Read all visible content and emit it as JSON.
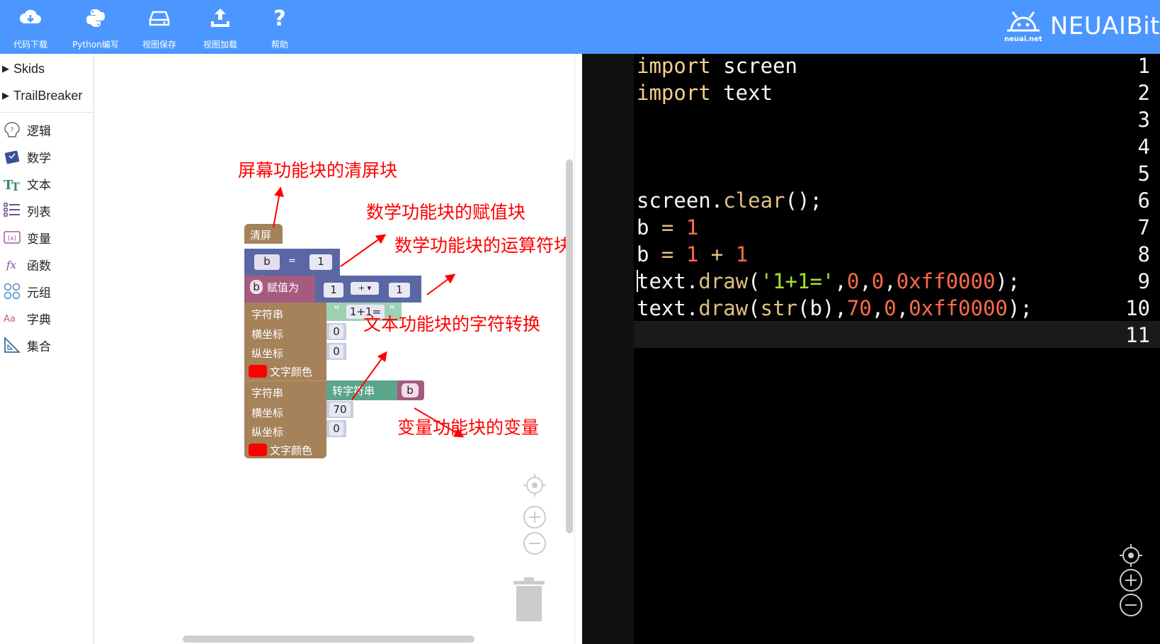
{
  "toolbar": {
    "buttons": [
      {
        "label": "代码下载",
        "icon": "cloud-download-icon"
      },
      {
        "label": "Python编写",
        "icon": "python-icon"
      },
      {
        "label": "视图保存",
        "icon": "drive-save-icon"
      },
      {
        "label": "视图加载",
        "icon": "upload-icon"
      },
      {
        "label": "帮助",
        "icon": "help-icon"
      }
    ],
    "brand_small": "neuai.net",
    "brand_name": "NEUAIBit",
    "color": "#4c97ff"
  },
  "toolbox": {
    "tree": [
      {
        "label": "Skids",
        "icon": "caret-right-icon"
      },
      {
        "label": "TrailBreaker",
        "icon": "caret-right-icon"
      }
    ],
    "categories": [
      {
        "label": "逻辑",
        "icon": "logic-icon"
      },
      {
        "label": "数学",
        "icon": "math-icon"
      },
      {
        "label": "文本",
        "icon": "text-icon"
      },
      {
        "label": "列表",
        "icon": "list-icon"
      },
      {
        "label": "变量",
        "icon": "variable-icon"
      },
      {
        "label": "函数",
        "icon": "function-icon"
      },
      {
        "label": "元组",
        "icon": "tuple-icon"
      },
      {
        "label": "字典",
        "icon": "dict-icon"
      },
      {
        "label": "集合",
        "icon": "set-icon"
      }
    ]
  },
  "blocks": {
    "clear_label": "清屏",
    "assign_var": "b",
    "assign_eq": "=",
    "assign_value": "1",
    "setvar_var": "b",
    "setvar_label": "赋值为",
    "op_left": "1",
    "op_symbol": "+ ▾",
    "op_right": "1",
    "draw1": {
      "string_label": "字符串",
      "string_value": "1+1=",
      "x_label": "横坐标",
      "x_value": "0",
      "y_label": "纵坐标",
      "y_value": "0",
      "color_label": "文字颜色"
    },
    "draw2": {
      "string_label": "字符串",
      "convert_label": "转字符串",
      "convert_var": "b",
      "x_label": "横坐标",
      "x_value": "70",
      "y_label": "纵坐标",
      "y_value": "0",
      "color_label": "文字颜色"
    },
    "text_color": "#ff0000"
  },
  "annotations": {
    "clear": "屏幕功能块的清屏块",
    "assign": "数学功能块的赋值块",
    "operator": "数学功能块的运算符块",
    "convert": "文本功能块的字符转换",
    "variable": "变量功能块的变量"
  },
  "editor": {
    "line_numbers": [
      "1",
      "2",
      "3",
      "4",
      "5",
      "6",
      "7",
      "8",
      "9",
      "10",
      "11"
    ],
    "lines": [
      "import screen",
      "import text",
      "",
      "",
      "",
      "screen.clear();",
      "b = 1",
      "b = 1 + 1",
      "text.draw('1+1=',0,0,0xff0000);",
      "text.draw(str(b),70,0,0xff0000);",
      ""
    ]
  }
}
